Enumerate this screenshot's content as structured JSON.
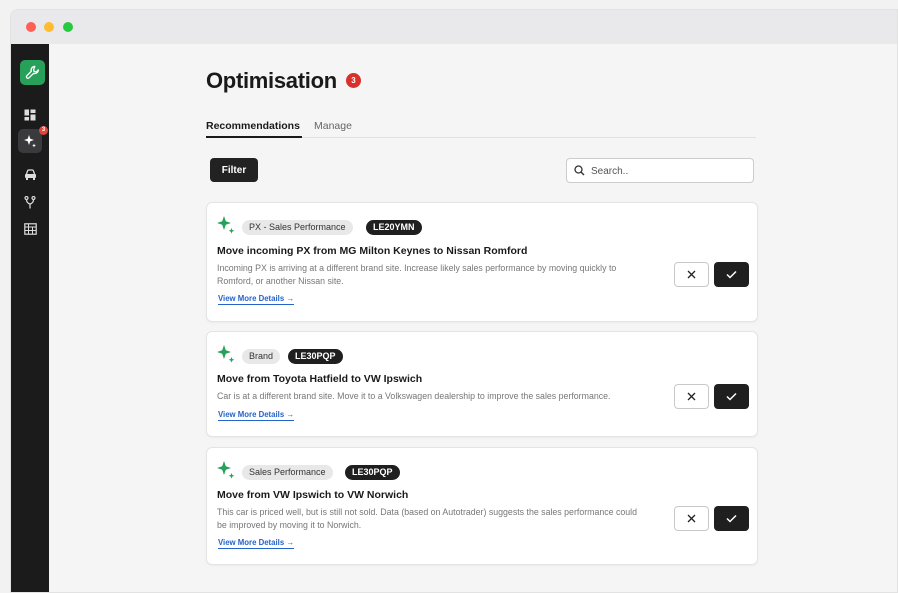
{
  "window": {
    "controls": [
      "close",
      "minimize",
      "zoom"
    ]
  },
  "sidebar": {
    "items": [
      {
        "icon": "dashboard-icon"
      },
      {
        "icon": "sparkle-icon",
        "badge": "3",
        "active": true
      },
      {
        "icon": "car-icon"
      },
      {
        "icon": "branch-icon"
      },
      {
        "icon": "building-icon"
      }
    ]
  },
  "page": {
    "title": "Optimisation",
    "badge": "3"
  },
  "tabs": [
    {
      "label": "Recommendations",
      "active": true
    },
    {
      "label": "Manage",
      "active": false
    }
  ],
  "toolbar": {
    "filter_label": "Filter",
    "search_placeholder": "Search.."
  },
  "cards": [
    {
      "category": "PX - Sales Performance",
      "plate": "LE20YMN",
      "title": "Move incoming PX from MG Milton Keynes to Nissan Romford",
      "description": "Incoming PX is arriving at a different brand site. Increase likely sales performance by moving quickly to Romford, or another Nissan site.",
      "link": "View More Details →"
    },
    {
      "category": "Brand",
      "plate": "LE30PQP",
      "title": "Move from Toyota Hatfield to VW Ipswich",
      "description": "Car is at a different brand site. Move it to a Volkswagen dealership to improve the sales performance.",
      "link": "View More Details →"
    },
    {
      "category": "Sales Performance",
      "plate": "LE30PQP",
      "title": "Move from VW Ipswich  to VW Norwich",
      "description": "This car is priced well, but is still not sold.  Data (based on Autotrader) suggests the sales performance could be improved by moving it to Norwich.",
      "link": "View More Details →"
    }
  ],
  "colors": {
    "accent_green": "#27a05a",
    "badge_red": "#d9302c",
    "link_blue": "#2563c9",
    "sidebar_bg": "#1b1b1c"
  }
}
